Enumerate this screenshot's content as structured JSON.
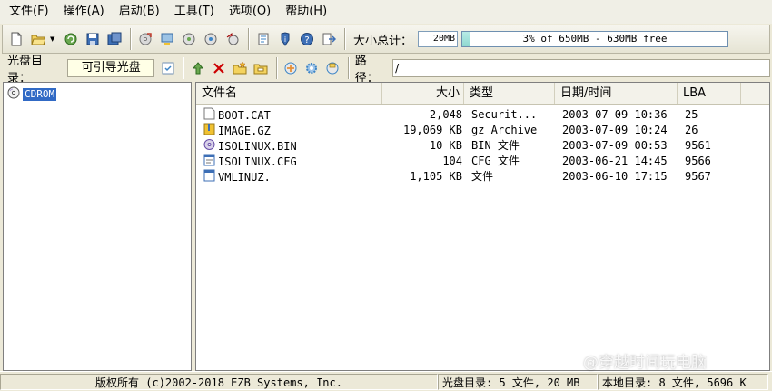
{
  "menubar": {
    "items": [
      "文件(F)",
      "操作(A)",
      "启动(B)",
      "工具(T)",
      "选项(O)",
      "帮助(H)"
    ]
  },
  "toolbar": {
    "size_total_label": "大小总计：",
    "size_selected": "20MB",
    "capacity_text": "3% of 650MB - 630MB free",
    "capacity_used_percent": 3,
    "icons": [
      "new-icon",
      "open-icon",
      "refresh-icon",
      "save-icon",
      "save-as-icon",
      "burn-icon",
      "mount-icon",
      "compress-icon",
      "extract-icon",
      "convert-icon",
      "properties-icon",
      "info-icon",
      "help-icon",
      "exit-icon"
    ]
  },
  "location": {
    "disc_dir_label": "光盘目录：",
    "volume_label": "可引导光盘",
    "path_label": "路径：",
    "path_value": "/"
  },
  "tree": {
    "root_label": "CDROM"
  },
  "files": {
    "columns": [
      "文件名",
      "大小",
      "类型",
      "日期/时间",
      "LBA"
    ],
    "rows": [
      {
        "name": "BOOT.CAT",
        "size": "2,048",
        "type": "Securit...",
        "date": "2003-07-09 10:36",
        "lba": "25",
        "icon": "file-icon"
      },
      {
        "name": "IMAGE.GZ",
        "size": "19,069 KB",
        "type": "gz Archive",
        "date": "2003-07-09 10:24",
        "lba": "26",
        "icon": "archive-icon"
      },
      {
        "name": "ISOLINUX.BIN",
        "size": "10 KB",
        "type": "BIN 文件",
        "date": "2003-07-09 00:53",
        "lba": "9561",
        "icon": "boot-bin-icon"
      },
      {
        "name": "ISOLINUX.CFG",
        "size": "104",
        "type": "CFG 文件",
        "date": "2003-06-21 14:45",
        "lba": "9566",
        "icon": "config-file-icon"
      },
      {
        "name": "VMLINUZ.",
        "size": "1,105 KB",
        "type": " 文件",
        "date": "2003-06-10 17:15",
        "lba": "9567",
        "icon": "generic-file-icon"
      }
    ]
  },
  "statusbar": {
    "copyright": "版权所有 (c)2002-2018 EZB Systems, Inc.",
    "disc_stats": "光盘目录: 5 文件, 20 MB",
    "local_stats": "本地目录: 8 文件, 5696 K"
  },
  "watermark": "@穿越时间玩电脑",
  "colors": {
    "selection": "#316ac5",
    "capacity_fill": "#8fd8d0",
    "window_bg": "#ece9d8"
  }
}
